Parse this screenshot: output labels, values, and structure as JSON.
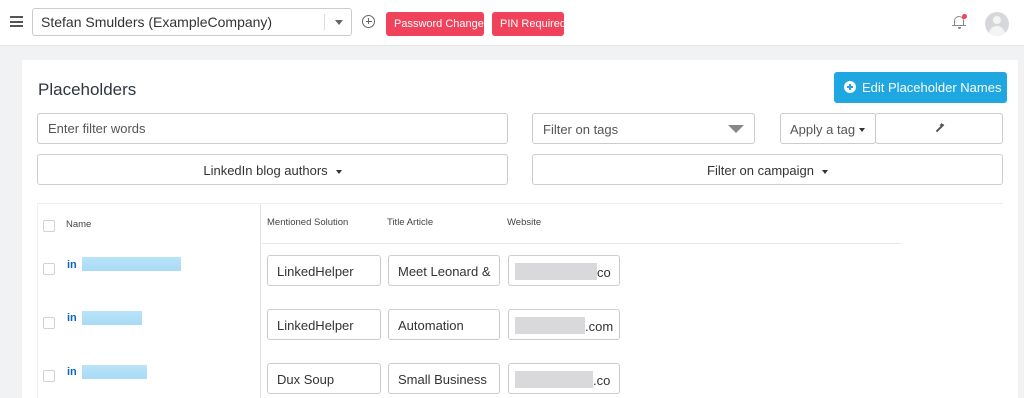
{
  "topbar": {
    "account": "Stefan Smulders (ExampleCompany)",
    "badges": [
      "Password Changed",
      "PIN Required"
    ]
  },
  "main": {
    "title": "Placeholders",
    "edit_button": "Edit Placeholder Names",
    "filter_placeholder": "Enter filter words",
    "tags_filter": "Filter on tags",
    "apply_tag": "Apply a tag",
    "blog_authors": "LinkedIn blog authors",
    "campaign_filter": "Filter on campaign"
  },
  "table": {
    "columns": [
      "Name",
      "Mentioned Solution",
      "Title Article",
      "Website"
    ],
    "rows": [
      {
        "solution": "LinkedHelper",
        "title": "Meet Leonard &",
        "website_tail": "co"
      },
      {
        "solution": "LinkedHelper",
        "title": "Automation",
        "website_tail": ".com"
      },
      {
        "solution": "Dux Soup",
        "title": "Small Business",
        "website_tail": ".co"
      }
    ]
  },
  "colors": {
    "accent": "#1ea7e0",
    "badge": "#f0435b",
    "linkedin": "#0a66c2"
  }
}
